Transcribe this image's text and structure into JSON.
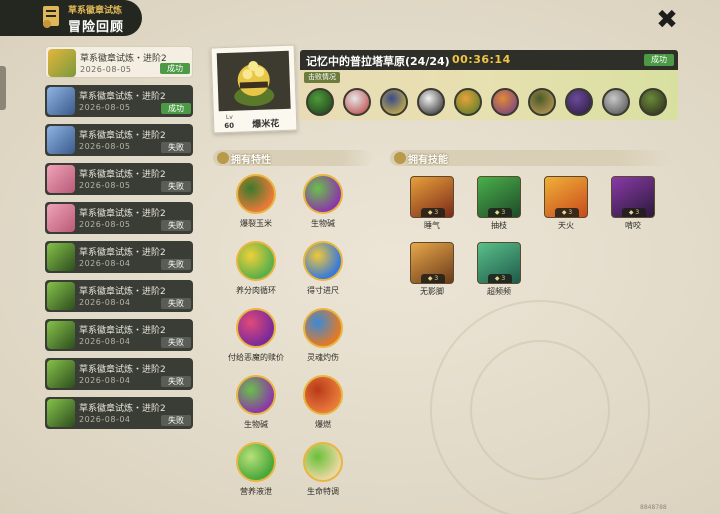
{
  "header": {
    "subtitle": "草系徽章试炼",
    "title": "冒险回顾"
  },
  "records": [
    {
      "name": "草系徽章试炼・进阶2",
      "date": "2026-08-05",
      "result": "成功",
      "status": "success",
      "active": true,
      "colors": [
        "#e5b53d",
        "#7a9a3a"
      ]
    },
    {
      "name": "草系徽章试炼・进阶2",
      "date": "2026-08-05",
      "result": "成功",
      "status": "success",
      "active": false,
      "colors": [
        "#8fb4e4",
        "#3a5a8a"
      ]
    },
    {
      "name": "草系徽章试炼・进阶2",
      "date": "2026-08-05",
      "result": "失败",
      "status": "fail",
      "active": false,
      "colors": [
        "#8fb4e4",
        "#3a5a8a"
      ]
    },
    {
      "name": "草系徽章试炼・进阶2",
      "date": "2026-08-05",
      "result": "失败",
      "status": "fail",
      "active": false,
      "colors": [
        "#f0a3b8",
        "#b85a78"
      ]
    },
    {
      "name": "草系徽章试炼・进阶2",
      "date": "2026-08-05",
      "result": "失败",
      "status": "fail",
      "active": false,
      "colors": [
        "#f0a3b8",
        "#b85a78"
      ]
    },
    {
      "name": "草系徽章试炼・进阶2",
      "date": "2026-08-04",
      "result": "失败",
      "status": "fail",
      "active": false,
      "colors": [
        "#86c24a",
        "#2d4d1e"
      ]
    },
    {
      "name": "草系徽章试炼・进阶2",
      "date": "2026-08-04",
      "result": "失败",
      "status": "fail",
      "active": false,
      "colors": [
        "#86c24a",
        "#2d4d1e"
      ]
    },
    {
      "name": "草系徽章试炼・进阶2",
      "date": "2026-08-04",
      "result": "失败",
      "status": "fail",
      "active": false,
      "colors": [
        "#86c24a",
        "#2d4d1e"
      ]
    },
    {
      "name": "草系徽章试炼・进阶2",
      "date": "2026-08-04",
      "result": "失败",
      "status": "fail",
      "active": false,
      "colors": [
        "#86c24a",
        "#2d4d1e"
      ]
    },
    {
      "name": "草系徽章试炼・进阶2",
      "date": "2026-08-04",
      "result": "失败",
      "status": "fail",
      "active": false,
      "colors": [
        "#86c24a",
        "#2d4d1e"
      ]
    }
  ],
  "detail": {
    "pet_name": "爆米花",
    "level_label": "Lv",
    "level": "60",
    "stage": "记忆中的普拉塔草原(24/24)",
    "timer": "00:36:14",
    "result": "成功",
    "defeat_label": "击败情况",
    "foes": [
      {
        "colors": [
          "#4e9a3a",
          "#1e3a1a"
        ]
      },
      {
        "colors": [
          "#e6e6e6",
          "#b83a3a"
        ]
      },
      {
        "colors": [
          "#3a4a8a",
          "#e6c43a"
        ]
      },
      {
        "colors": [
          "#f2f2f2",
          "#202020"
        ]
      },
      {
        "colors": [
          "#e6a23a",
          "#4a7a2a"
        ]
      },
      {
        "colors": [
          "#e08a3a",
          "#6a3a8a"
        ]
      },
      {
        "colors": [
          "#4a5a2a",
          "#c8a05a"
        ]
      },
      {
        "colors": [
          "#6a4a9a",
          "#2a1a3a"
        ]
      },
      {
        "colors": [
          "#c8c8c8",
          "#4a4a4a"
        ]
      },
      {
        "colors": [
          "#6a8a3a",
          "#2a2a1a"
        ]
      }
    ]
  },
  "traits_section": {
    "title": "拥有特性"
  },
  "traits": [
    {
      "name": "爆裂玉米",
      "colors": [
        "#e87a3a",
        "#3a7a2a"
      ]
    },
    {
      "name": "生物碱",
      "colors": [
        "#8a3aa8",
        "#6ac04a"
      ]
    },
    {
      "name": "养分肉循环",
      "colors": [
        "#5ab04a",
        "#f0d03a"
      ]
    },
    {
      "name": "得寸进尺",
      "colors": [
        "#3a7ad8",
        "#f0c83a"
      ]
    },
    {
      "name": "付给恶魔的赎价",
      "colors": [
        "#7a2a9a",
        "#e04a7a"
      ]
    },
    {
      "name": "灵魂灼伤",
      "colors": [
        "#e07a2a",
        "#3a8ad8"
      ]
    },
    {
      "name": "生物碱",
      "colors": [
        "#8a3aa8",
        "#6ac04a"
      ]
    },
    {
      "name": "爆燃",
      "colors": [
        "#e87a3a",
        "#b83a1a"
      ]
    },
    {
      "name": "营养液泄",
      "colors": [
        "#4aa83a",
        "#b8e07a"
      ]
    },
    {
      "name": "生命特调",
      "colors": [
        "#e8d8a0",
        "#6ac03a"
      ]
    }
  ],
  "skills_section": {
    "title": "拥有技能"
  },
  "skills": [
    {
      "name": "睡气",
      "cost": "3",
      "colors": [
        "#e8a03a",
        "#7a2a1a"
      ]
    },
    {
      "name": "抽枝",
      "cost": "3",
      "colors": [
        "#4ab04a",
        "#1e4a2a"
      ]
    },
    {
      "name": "天火",
      "cost": "3",
      "colors": [
        "#f0b03a",
        "#c84a1a"
      ]
    },
    {
      "name": "啃咬",
      "cost": "3",
      "colors": [
        "#8a3aa8",
        "#2a1a3a"
      ]
    },
    {
      "name": "无影脚",
      "cost": "3",
      "colors": [
        "#e8a84a",
        "#6a3a1a"
      ]
    },
    {
      "name": "超频频",
      "cost": "3",
      "colors": [
        "#5ac08a",
        "#1e5a4a"
      ]
    }
  ],
  "footer": {
    "uid": "8848788"
  }
}
